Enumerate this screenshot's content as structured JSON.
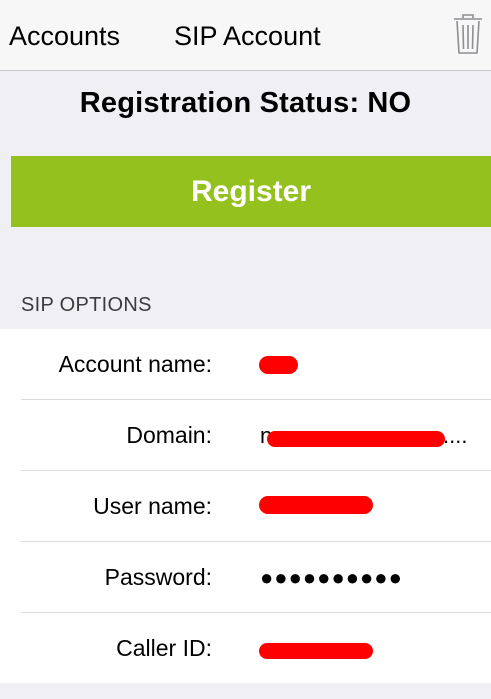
{
  "navbar": {
    "back_label": "Accounts",
    "title": "SIP Account",
    "trash_icon": "trash-icon"
  },
  "status": {
    "label": "Registration Status:",
    "value": "NO"
  },
  "register_button": {
    "label": "Register",
    "color": "#95c11f"
  },
  "sip_options": {
    "header": "SIP OPTIONS",
    "fields": [
      {
        "label": "Account name:",
        "value": ""
      },
      {
        "label": "Domain:",
        "value": "n",
        "trailing": "...."
      },
      {
        "label": "User name:",
        "value": ""
      },
      {
        "label": "Password:",
        "value": "●●●●●●●●●●"
      },
      {
        "label": "Caller ID:",
        "value": ""
      }
    ]
  },
  "colors": {
    "accent_green": "#95c11f",
    "redaction_red": "#ff0000",
    "background": "#efeff4"
  }
}
